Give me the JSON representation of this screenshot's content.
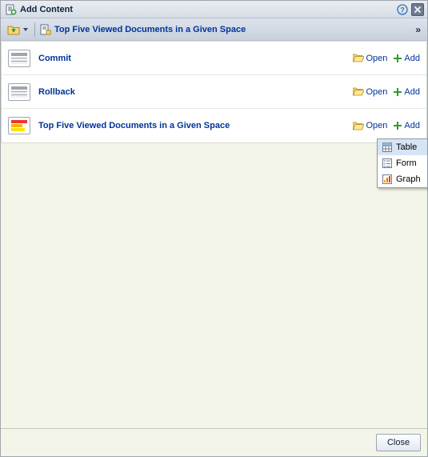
{
  "dialog": {
    "title": "Add Content"
  },
  "toolbar": {
    "breadcrumb": "Top Five Viewed Documents in a Given Space",
    "expand_glyph": "»"
  },
  "actions": {
    "open_label": "Open",
    "add_label": "Add"
  },
  "rows": [
    {
      "title": "Commit",
      "icon": "portlet"
    },
    {
      "title": "Rollback",
      "icon": "portlet"
    },
    {
      "title": "Top Five Viewed Documents in a Given Space",
      "icon": "chart"
    }
  ],
  "popup": {
    "items": [
      {
        "label": "Table",
        "icon": "table-icon",
        "selected": true
      },
      {
        "label": "Form",
        "icon": "form-icon",
        "selected": false
      },
      {
        "label": "Graph",
        "icon": "graph-icon",
        "selected": false
      }
    ]
  },
  "footer": {
    "close_label": "Close"
  }
}
